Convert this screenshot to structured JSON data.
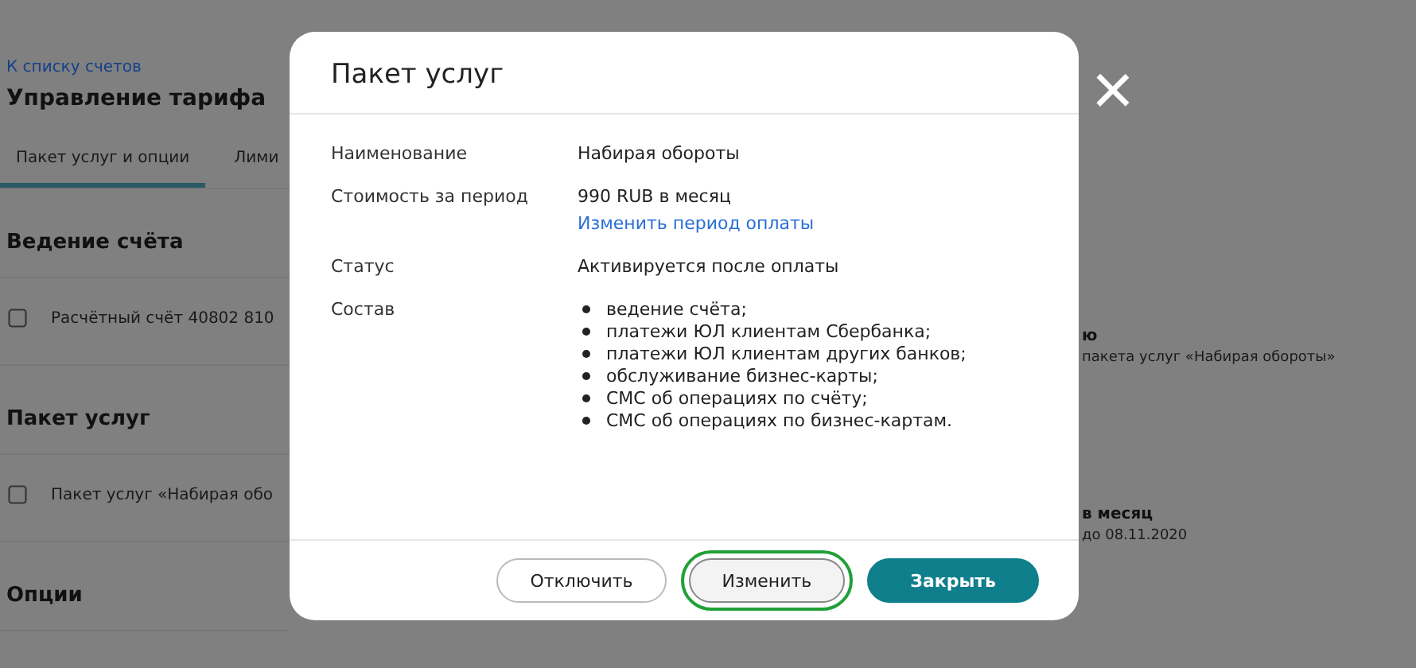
{
  "background": {
    "back_link": "К списку счетов",
    "title": "Управление тарифа",
    "tabs": [
      {
        "label": "Пакет услуг и опции",
        "selected": true
      },
      {
        "label": "Лими",
        "selected": false
      }
    ],
    "sections": [
      {
        "heading": "Ведение счёта",
        "row": "Расчётный счёт 40802 810",
        "right_title": "ю",
        "right_text": "пакета услуг «Набирая обороты»"
      },
      {
        "heading": "Пакет услуг",
        "row": "Пакет услуг «Набирая обо",
        "right_title": "в месяц",
        "right_text": "до 08.11.2020"
      },
      {
        "heading": "Опции"
      }
    ]
  },
  "dialog": {
    "title": "Пакет услуг",
    "close": "×",
    "fields": [
      {
        "label": "Наименование",
        "value": "Набирая обороты"
      },
      {
        "label": "Стоимость за период",
        "value": "990 RUB в месяц",
        "link": "Изменить период оплаты"
      },
      {
        "label": "Статус",
        "value": "Активируется после оплаты"
      },
      {
        "label": "Состав",
        "items": [
          "ведение счёта;",
          "платежи ЮЛ клиентам Сбербанка;",
          "платежи ЮЛ клиентам других банков;",
          "обслуживание бизнес-карты;",
          "СМС об операциях по счёту;",
          "СМС об операциях по бизнес-картам."
        ]
      }
    ],
    "buttons": [
      {
        "label": "Отключить",
        "kind": "secondary",
        "focused": false
      },
      {
        "label": "Изменить",
        "kind": "secondary",
        "focused": true
      },
      {
        "label": "Закрыть",
        "kind": "primary",
        "focused": false
      }
    ]
  }
}
